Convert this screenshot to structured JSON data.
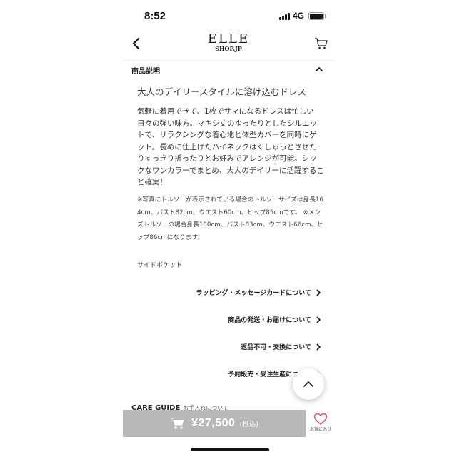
{
  "status_bar": {
    "time": "8:52",
    "network": "4G"
  },
  "header": {
    "logo_main": "ELLE",
    "logo_sub": "SHOP.JP"
  },
  "section": {
    "title": "商品説明"
  },
  "description": {
    "title": "大人のデイリースタイルに溶け込むドレス",
    "body": "気軽に着用できて、1枚でサマになるドレスは忙しい日々の強い味方。マキシ丈のゆったりとしたシルエットで、リラクシングな着心地と体型カバーを同時にゲット。長めに仕上げたハイネックはくしゅっとさせたりすっきり折ったりとお好みでアレンジが可能。シックなワンカラーでまとめ、大人のデイリーに活躍すること確実！",
    "note": "※写真にトルソーが表示されている場合のトルソーサイズは身長164cm、バスト82cm、ウエスト60cm、ヒップ85cmです。 ※メンズトルソーの場合身長180cm、バスト83cm、ウエスト66cm、ヒップ86cmになります。",
    "feature": "サイドポケット"
  },
  "links": [
    {
      "label": "ラッピング・メッセージカードについて"
    },
    {
      "label": "商品の発送・お届けについて"
    },
    {
      "label": "返品不可・交換について"
    },
    {
      "label": "予約販売・受注生産について"
    }
  ],
  "care_guide": {
    "title": "CARE GUIDE",
    "subtitle": "お手入れについて"
  },
  "purchase": {
    "price": "¥27,500",
    "tax_note": "(税込)"
  },
  "favorite": {
    "label": "お気に入り"
  },
  "colors": {
    "buy_bar": "#b8b8b8",
    "favorite_heart": "#e0457b"
  }
}
